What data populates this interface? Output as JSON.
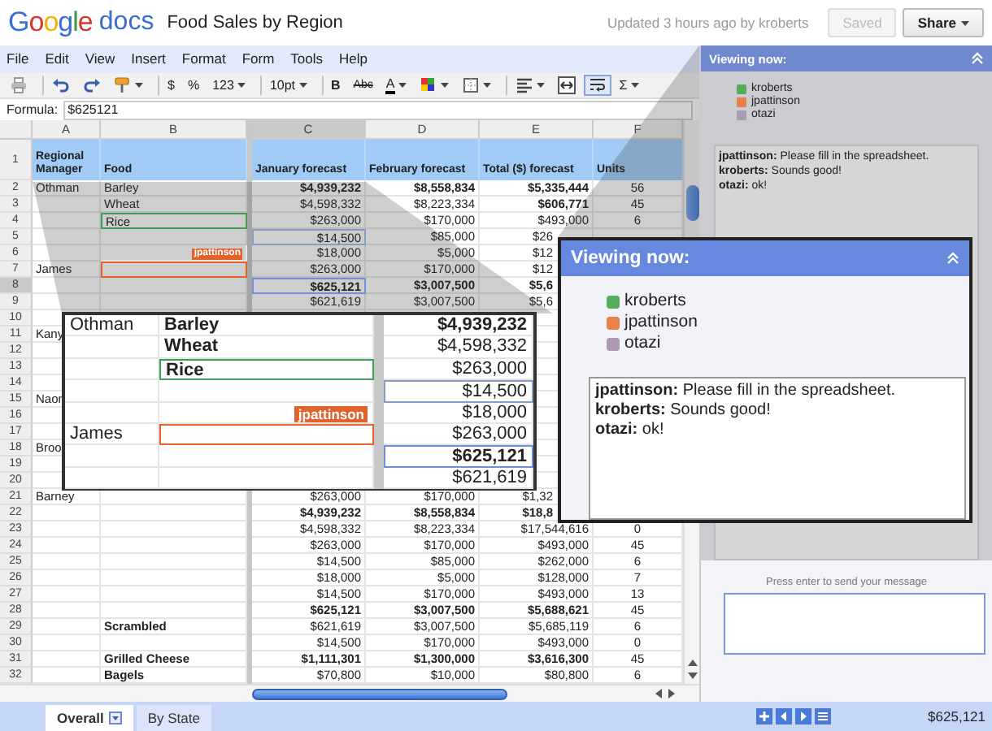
{
  "header": {
    "logo": "Google",
    "product": "docs",
    "title": "Food Sales by Region",
    "updated": "Updated 3 hours ago by kroberts",
    "buttons": [
      {
        "label": "Saved",
        "disabled": true,
        "menu": false
      },
      {
        "label": "Share",
        "disabled": false,
        "menu": true
      }
    ]
  },
  "menu": [
    "File",
    "Edit",
    "View",
    "Insert",
    "Format",
    "Form",
    "Tools",
    "Help"
  ],
  "toolbar": [
    {
      "kind": "print",
      "pressed": false,
      "menu": false,
      "group_start": false
    },
    {
      "kind": "undo",
      "pressed": false,
      "menu": false,
      "group_start": true
    },
    {
      "kind": "redo",
      "pressed": false,
      "menu": false,
      "group_start": false
    },
    {
      "kind": "paint-format",
      "pressed": false,
      "menu": true,
      "group_start": false
    },
    {
      "kind": "text",
      "label": "$",
      "pressed": false,
      "menu": false,
      "group_start": true
    },
    {
      "kind": "text",
      "label": "%",
      "pressed": false,
      "menu": false,
      "group_start": false
    },
    {
      "kind": "text",
      "label": "123",
      "pressed": false,
      "menu": true,
      "group_start": false
    },
    {
      "kind": "text",
      "label": "10pt",
      "pressed": false,
      "menu": true,
      "group_start": true
    },
    {
      "kind": "bold",
      "label": "B",
      "pressed": false,
      "menu": false,
      "group_start": true
    },
    {
      "kind": "strike",
      "label": "Abc",
      "pressed": false,
      "menu": false,
      "group_start": false
    },
    {
      "kind": "text-color",
      "label": "A",
      "pressed": false,
      "menu": true,
      "group_start": false
    },
    {
      "kind": "fill-color",
      "pressed": false,
      "menu": true,
      "group_start": false
    },
    {
      "kind": "borders",
      "pressed": false,
      "menu": true,
      "group_start": false
    },
    {
      "kind": "align",
      "pressed": false,
      "menu": true,
      "group_start": true
    },
    {
      "kind": "merge",
      "pressed": false,
      "menu": false,
      "group_start": false
    },
    {
      "kind": "wrap",
      "pressed": true,
      "menu": false,
      "group_start": false
    },
    {
      "kind": "sum",
      "label": "Σ",
      "pressed": false,
      "menu": true,
      "group_start": false
    }
  ],
  "formula": {
    "label": "Formula:",
    "value": "$625121"
  },
  "sheet": {
    "columns": [
      {
        "letter": "A",
        "selected": false
      },
      {
        "letter": "B",
        "selected": false
      },
      {
        "letter": "C",
        "selected": true
      },
      {
        "letter": "D",
        "selected": false
      },
      {
        "letter": "E",
        "selected": false
      },
      {
        "letter": "F",
        "selected": false
      }
    ],
    "header_row": {
      "number": "1",
      "cells": [
        "Regional Manager",
        "Food",
        "January forecast",
        "February forecast",
        "Total ($) forecast",
        "Units"
      ]
    },
    "rows": [
      {
        "number": "2",
        "selected": false,
        "cells": [
          {
            "text": "Othman",
            "bold": false
          },
          {
            "text": "Barley",
            "bold": false
          },
          {
            "text": "$4,939,232",
            "bold": true
          },
          {
            "text": "$8,558,834",
            "bold": true
          },
          {
            "text": "$5,335,444",
            "bold": true
          },
          {
            "text": "56",
            "bold": false
          }
        ]
      },
      {
        "number": "3",
        "selected": false,
        "cells": [
          null,
          {
            "text": "Wheat",
            "bold": false
          },
          {
            "text": "$4,598,332",
            "bold": false
          },
          {
            "text": "$8,223,334",
            "bold": false
          },
          {
            "text": "$606,771",
            "bold": true
          },
          {
            "text": "45",
            "bold": false
          }
        ]
      },
      {
        "number": "4",
        "selected": false,
        "cells": [
          null,
          {
            "text": "Rice",
            "bold": false,
            "color": "#3f9e4f"
          },
          {
            "text": "$263,000",
            "bold": false
          },
          {
            "text": "$170,000",
            "bold": false
          },
          {
            "text": "$493,000",
            "bold": false
          },
          {
            "text": "6",
            "bold": false
          }
        ]
      },
      {
        "number": "5",
        "selected": false,
        "cells": [
          null,
          null,
          {
            "text": "$14,500",
            "bold": false,
            "color": "#8a9bc6"
          },
          {
            "text": "$85,000",
            "bold": false
          },
          {
            "text": "$26",
            "bold": false,
            "cut": true
          },
          null
        ]
      },
      {
        "number": "6",
        "selected": false,
        "cells": [
          null,
          {
            "bold": true,
            "color": "#e2622c",
            "tag": "jpattinson"
          },
          {
            "text": "$18,000",
            "bold": false
          },
          {
            "text": "$5,000",
            "bold": false
          },
          {
            "text": "$12",
            "bold": false,
            "cut": true
          },
          null
        ]
      },
      {
        "number": "7",
        "selected": false,
        "cells": [
          {
            "text": "James",
            "bold": false
          },
          {
            "color": "#e2622c"
          },
          {
            "text": "$263,000",
            "bold": false
          },
          {
            "text": "$170,000",
            "bold": false
          },
          {
            "text": "$12",
            "bold": false,
            "cut": true
          },
          null
        ]
      },
      {
        "number": "8",
        "selected": true,
        "cells": [
          null,
          null,
          {
            "text": "$625,121",
            "bold": true,
            "color": "#6f8fdc"
          },
          {
            "text": "$3,007,500",
            "bold": true
          },
          {
            "text": "$5,6",
            "bold": true,
            "cut": true
          },
          null
        ]
      },
      {
        "number": "9",
        "selected": false,
        "cells": [
          null,
          null,
          {
            "text": "$621,619",
            "bold": false
          },
          {
            "text": "$3,007,500",
            "bold": false
          },
          {
            "text": "$5,6",
            "bold": false,
            "cut": true
          },
          null
        ]
      },
      {
        "number": "10",
        "selected": false,
        "cells": [
          null,
          null,
          null,
          null,
          null,
          null
        ]
      },
      {
        "number": "11",
        "selected": false,
        "cells": [
          {
            "text": "Kany",
            "bold": false
          },
          null,
          null,
          null,
          null,
          null
        ]
      },
      {
        "number": "12",
        "selected": false,
        "cells": [
          null,
          null,
          null,
          null,
          null,
          null
        ]
      },
      {
        "number": "13",
        "selected": false,
        "cells": [
          null,
          null,
          null,
          null,
          null,
          null
        ]
      },
      {
        "number": "14",
        "selected": false,
        "cells": [
          null,
          null,
          null,
          null,
          null,
          null
        ]
      },
      {
        "number": "15",
        "selected": false,
        "cells": [
          {
            "text": "Naon",
            "bold": false
          },
          null,
          null,
          null,
          null,
          null
        ]
      },
      {
        "number": "16",
        "selected": false,
        "cells": [
          null,
          null,
          null,
          null,
          null,
          null
        ]
      },
      {
        "number": "17",
        "selected": false,
        "cells": [
          null,
          null,
          null,
          null,
          null,
          null
        ]
      },
      {
        "number": "18",
        "selected": false,
        "cells": [
          {
            "text": "Broo",
            "bold": false
          },
          null,
          null,
          null,
          null,
          null
        ]
      },
      {
        "number": "19",
        "selected": false,
        "cells": [
          null,
          null,
          null,
          null,
          null,
          null
        ]
      },
      {
        "number": "20",
        "selected": false,
        "cells": [
          null,
          null,
          null,
          null,
          null,
          null
        ]
      },
      {
        "number": "21",
        "selected": false,
        "cells": [
          {
            "text": "Barney",
            "bold": false
          },
          null,
          {
            "text": "$263,000",
            "bold": false
          },
          {
            "text": "$170,000",
            "bold": false
          },
          {
            "text": "$1,32",
            "bold": false,
            "cut": true
          },
          null
        ]
      },
      {
        "number": "22",
        "selected": false,
        "cells": [
          null,
          null,
          {
            "text": "$4,939,232",
            "bold": true
          },
          {
            "text": "$8,558,834",
            "bold": true
          },
          {
            "text": "$18,8",
            "bold": true,
            "cut": true
          },
          null
        ]
      },
      {
        "number": "23",
        "selected": false,
        "cells": [
          null,
          null,
          {
            "text": "$4,598,332",
            "bold": false
          },
          {
            "text": "$8,223,334",
            "bold": false
          },
          {
            "text": "$17,544,616",
            "bold": false
          },
          {
            "text": "0",
            "bold": false
          }
        ]
      },
      {
        "number": "24",
        "selected": false,
        "cells": [
          null,
          null,
          {
            "text": "$263,000",
            "bold": false
          },
          {
            "text": "$170,000",
            "bold": false
          },
          {
            "text": "$493,000",
            "bold": false
          },
          {
            "text": "45",
            "bold": false
          }
        ]
      },
      {
        "number": "25",
        "selected": false,
        "cells": [
          null,
          null,
          {
            "text": "$14,500",
            "bold": false
          },
          {
            "text": "$85,000",
            "bold": false
          },
          {
            "text": "$262,000",
            "bold": false
          },
          {
            "text": "6",
            "bold": false
          }
        ]
      },
      {
        "number": "26",
        "selected": false,
        "cells": [
          null,
          null,
          {
            "text": "$18,000",
            "bold": false
          },
          {
            "text": "$5,000",
            "bold": false
          },
          {
            "text": "$128,000",
            "bold": false
          },
          {
            "text": "7",
            "bold": false
          }
        ]
      },
      {
        "number": "27",
        "selected": false,
        "cells": [
          null,
          null,
          {
            "text": "$14,500",
            "bold": false
          },
          {
            "text": "$170,000",
            "bold": false
          },
          {
            "text": "$493,000",
            "bold": false
          },
          {
            "text": "13",
            "bold": false
          }
        ]
      },
      {
        "number": "28",
        "selected": false,
        "cells": [
          null,
          null,
          {
            "text": "$625,121",
            "bold": true
          },
          {
            "text": "$3,007,500",
            "bold": true
          },
          {
            "text": "$5,688,621",
            "bold": true
          },
          {
            "text": "45",
            "bold": false
          }
        ]
      },
      {
        "number": "29",
        "selected": false,
        "cells": [
          null,
          {
            "text": "Scrambled",
            "bold": true
          },
          {
            "text": "$621,619",
            "bold": false
          },
          {
            "text": "$3,007,500",
            "bold": false
          },
          {
            "text": "$5,685,119",
            "bold": false
          },
          {
            "text": "6",
            "bold": false
          }
        ]
      },
      {
        "number": "30",
        "selected": false,
        "cells": [
          null,
          null,
          {
            "text": "$14,500",
            "bold": false
          },
          {
            "text": "$170,000",
            "bold": false
          },
          {
            "text": "$493,000",
            "bold": false
          },
          {
            "text": "0",
            "bold": false
          }
        ]
      },
      {
        "number": "31",
        "selected": false,
        "cells": [
          null,
          {
            "text": "Grilled Cheese",
            "bold": true
          },
          {
            "text": "$1,111,301",
            "bold": true
          },
          {
            "text": "$1,300,000",
            "bold": true
          },
          {
            "text": "$3,616,300",
            "bold": true
          },
          {
            "text": "45",
            "bold": false
          }
        ]
      },
      {
        "number": "32",
        "selected": false,
        "cells": [
          null,
          {
            "text": "Bagels",
            "bold": true
          },
          {
            "text": "$70,800",
            "bold": false
          },
          {
            "text": "$10,000",
            "bold": false
          },
          {
            "text": "$80,800",
            "bold": false
          },
          {
            "text": "6",
            "bold": false
          }
        ]
      }
    ]
  },
  "zoom_inset": {
    "rows": [
      [
        {
          "text": "Othman",
          "bold": false
        },
        {
          "text": "Barley",
          "bold": true
        },
        {
          "text": "$4,939,232",
          "bold": true
        }
      ],
      [
        null,
        {
          "text": "Wheat",
          "bold": true
        },
        {
          "text": "$4,598,332",
          "bold": false
        }
      ],
      [
        null,
        {
          "text": "Rice",
          "bold": true,
          "color": "#3f9e4f"
        },
        {
          "text": "$263,000",
          "bold": false
        }
      ],
      [
        null,
        null,
        {
          "text": "$14,500",
          "bold": false,
          "color": "#8a9bc6"
        }
      ],
      [
        null,
        {
          "bold": true,
          "color": "#e2622c",
          "tag": "jpattinson"
        },
        {
          "text": "$18,000",
          "bold": false
        }
      ],
      [
        {
          "text": "James",
          "bold": false
        },
        {
          "color": "#e2622c"
        },
        {
          "text": "$263,000",
          "bold": false
        }
      ],
      [
        null,
        null,
        {
          "text": "$625,121",
          "bold": true,
          "color": "#6f8fdc"
        }
      ],
      [
        null,
        null,
        {
          "text": "$621,619",
          "bold": false
        }
      ]
    ]
  },
  "side_panel": {
    "title": "Viewing now:",
    "viewers": [
      {
        "name": "kroberts",
        "color": "#55ad5c"
      },
      {
        "name": "jpattinson",
        "color": "#e9804f"
      },
      {
        "name": "otazi",
        "color": "#ad98b4"
      }
    ],
    "chat": [
      "**jpattinson:** Please fill in the spreadsheet.",
      "**kroberts:** Sounds good!",
      "**otazi:** ok!"
    ],
    "hint": "Press enter to send your message"
  },
  "zoom_popup": {
    "title": "Viewing now:",
    "viewers": [
      {
        "name": "kroberts",
        "color": "#55ad5c"
      },
      {
        "name": "jpattinson",
        "color": "#e9804f"
      },
      {
        "name": "otazi",
        "color": "#ad98b4"
      }
    ],
    "chat": [
      "**jpattinson:** Please fill in the spreadsheet.",
      "**kroberts:** Sounds good!",
      "**otazi:** ok!"
    ]
  },
  "sheet_tabs": [
    {
      "label": "Overall",
      "selected": true,
      "menu": true
    },
    {
      "label": "By State",
      "selected": false,
      "menu": false
    }
  ],
  "nav_buttons": [
    {
      "kind": "add"
    },
    {
      "kind": "prev"
    },
    {
      "kind": "next"
    },
    {
      "kind": "list"
    }
  ],
  "status": "$625,121"
}
